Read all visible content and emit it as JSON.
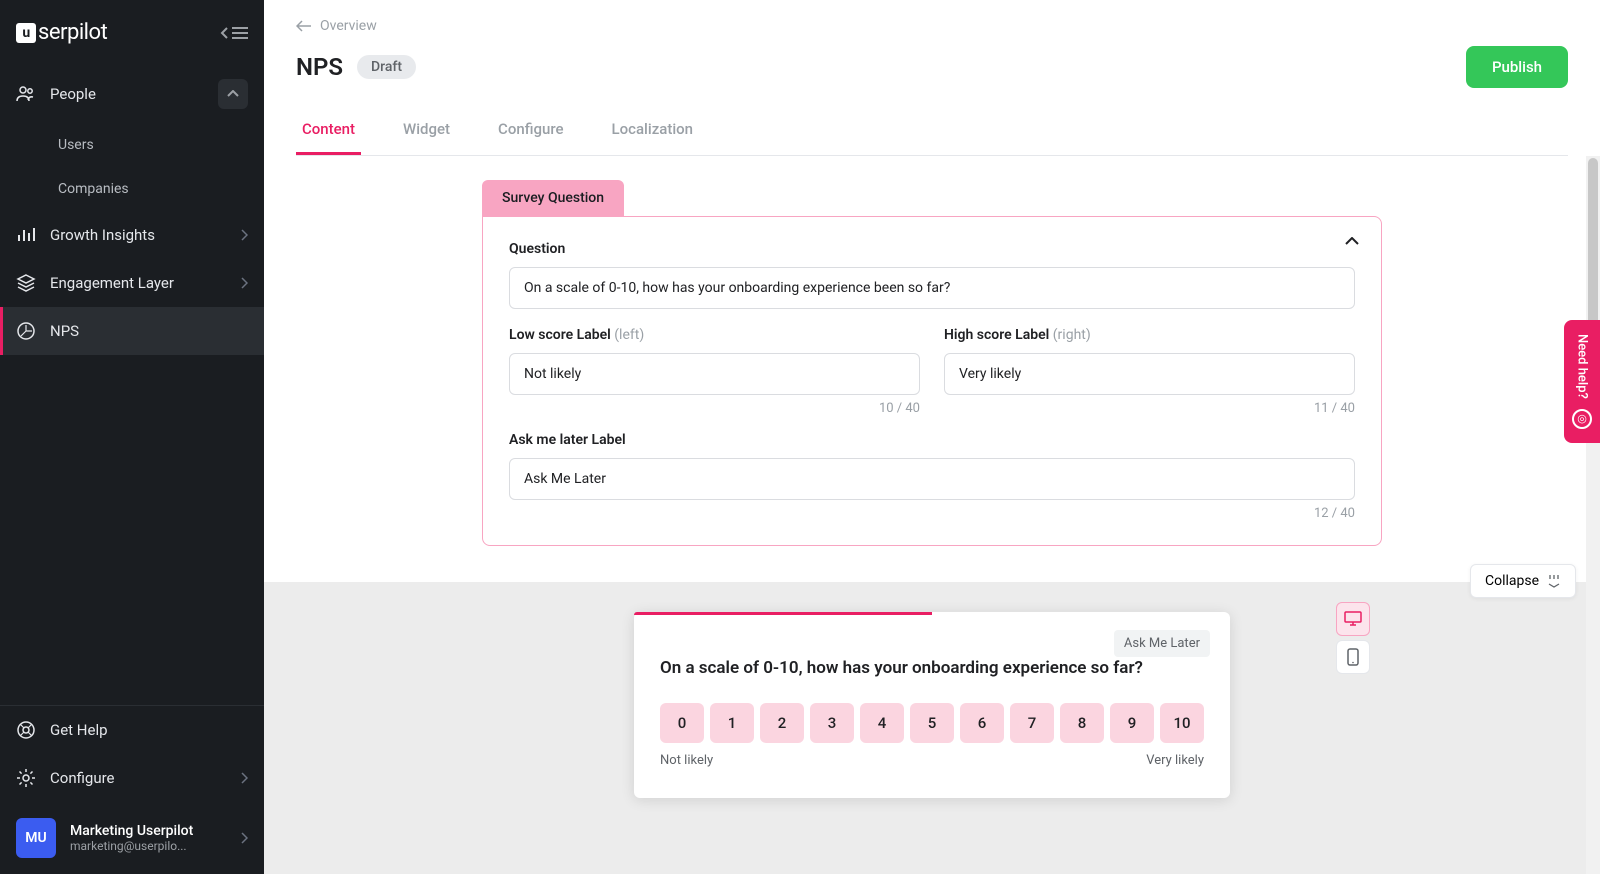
{
  "brand": "serpilot",
  "sidebar": {
    "items": {
      "people": "People",
      "users": "Users",
      "companies": "Companies",
      "growth": "Growth Insights",
      "engagement": "Engagement Layer",
      "nps": "NPS"
    },
    "footer": {
      "get_help": "Get Help",
      "configure": "Configure"
    },
    "account": {
      "initials": "MU",
      "name": "Marketing Userpilot",
      "email": "marketing@userpilo..."
    }
  },
  "breadcrumb": "Overview",
  "page": {
    "title": "NPS",
    "status": "Draft",
    "publish": "Publish"
  },
  "tabs": {
    "content": "Content",
    "widget": "Widget",
    "configure": "Configure",
    "localization": "Localization"
  },
  "editor": {
    "section_title": "Survey Question",
    "question_label": "Question",
    "question_value": "On a scale of 0-10, how has your onboarding experience been so far?",
    "low_label": "Low score Label",
    "low_hint": "(left)",
    "low_value": "Not likely",
    "low_count": "10 / 40",
    "high_label": "High score Label",
    "high_hint": "(right)",
    "high_value": "Very likely",
    "high_count": "11 / 40",
    "later_label": "Ask me later Label",
    "later_value": "Ask Me Later",
    "later_count": "12 / 40"
  },
  "preview": {
    "ask_later": "Ask Me Later",
    "question": "On a scale of 0-10, how has your onboarding experience so far?",
    "scale": [
      "0",
      "1",
      "2",
      "3",
      "4",
      "5",
      "6",
      "7",
      "8",
      "9",
      "10"
    ],
    "low": "Not likely",
    "high": "Very likely"
  },
  "collapse_label": "Collapse",
  "help_label": "Need help?"
}
